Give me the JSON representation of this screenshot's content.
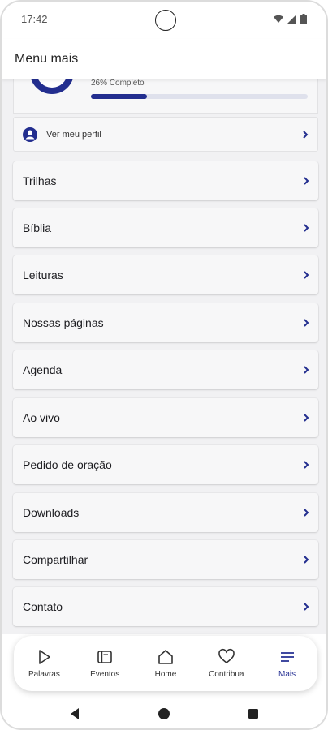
{
  "status_bar": {
    "time": "17:42"
  },
  "header": {
    "title": "Menu mais"
  },
  "progress": {
    "label": "26% Completo",
    "value": 0.26
  },
  "profile": {
    "label": "Ver meu perfil"
  },
  "menu_items": [
    {
      "label": "Trilhas"
    },
    {
      "label": "Bíblia"
    },
    {
      "label": "Leituras"
    },
    {
      "label": "Nossas páginas"
    },
    {
      "label": "Agenda"
    },
    {
      "label": "Ao vivo"
    },
    {
      "label": "Pedido de oração"
    },
    {
      "label": "Downloads"
    },
    {
      "label": "Compartilhar"
    },
    {
      "label": "Contato"
    }
  ],
  "bottom_nav": [
    {
      "label": "Palavras",
      "icon": "play-icon"
    },
    {
      "label": "Eventos",
      "icon": "calendar-icon"
    },
    {
      "label": "Home",
      "icon": "home-icon"
    },
    {
      "label": "Contribua",
      "icon": "heart-icon"
    },
    {
      "label": "Mais",
      "icon": "menu-icon",
      "active": true
    }
  ],
  "colors": {
    "accent": "#232e8f",
    "background": "#f1f1f3",
    "card": "#f7f7f8"
  }
}
